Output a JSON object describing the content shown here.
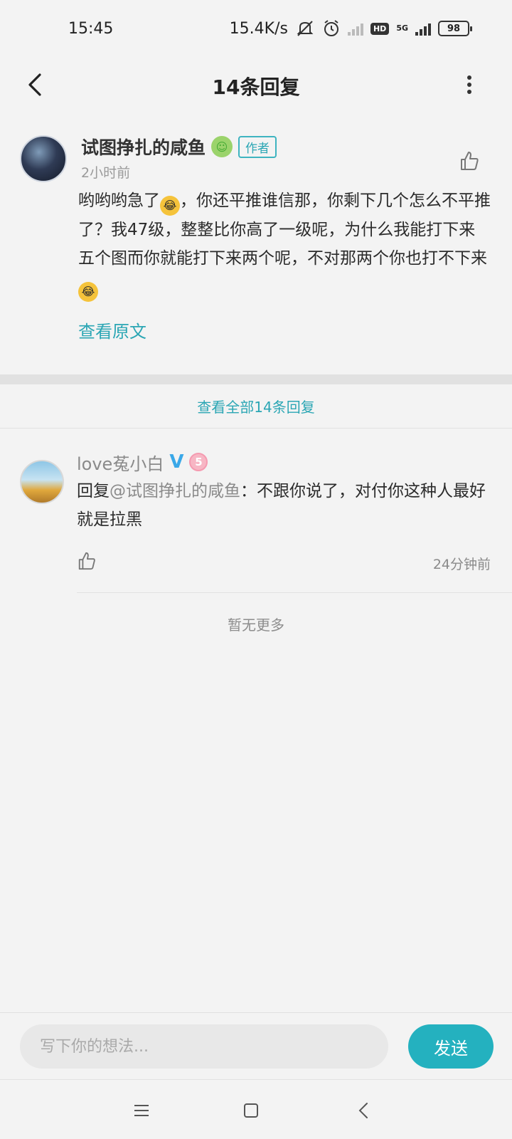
{
  "status_bar": {
    "time": "15:45",
    "net_speed": "15.4K/s",
    "network": "5G",
    "hd": "HD",
    "battery": "98",
    "icons": [
      "mute-icon",
      "alarm-icon",
      "signal-weak-icon",
      "hd-icon",
      "signal-5g-icon",
      "battery-icon"
    ]
  },
  "header": {
    "title": "14条回复",
    "back_icon": "chevron-left-icon",
    "more_icon": "more-vertical-icon"
  },
  "main_post": {
    "author": "试图挣扎的咸鱼",
    "author_tag": "作者",
    "time": "2小时前",
    "text_parts": [
      "哟哟哟急了",
      "，你还平推谁信那，你剩下几个怎么不平推了？我47级，整整比你高了一级呢，为什么我能打下来五个图而你就能打下来两个呢，不对那两个你也打不下来"
    ],
    "emoji": "rolling-on-floor-laughing-emoji",
    "view_original": "查看原文"
  },
  "view_all": "查看全部14条回复",
  "replies": [
    {
      "user": "love菟小白",
      "verified": "V",
      "level": "5",
      "prefix": "回复",
      "mention": "@试图挣扎的咸鱼",
      "text": "：不跟你说了，对付你这种人最好就是拉黑",
      "time": "24分钟前"
    }
  ],
  "no_more": "暂无更多",
  "composer": {
    "placeholder": "写下你的想法...",
    "send_label": "发送"
  },
  "colors": {
    "accent": "#24b1bf",
    "background": "#f3f3f3"
  }
}
